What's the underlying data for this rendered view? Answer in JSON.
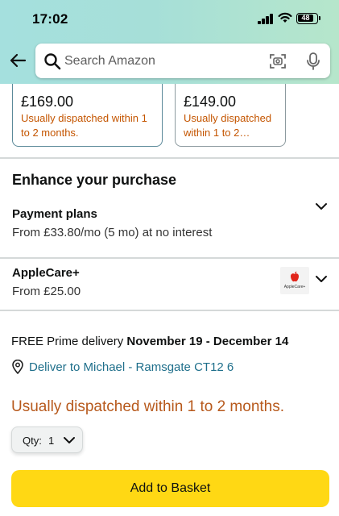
{
  "status_bar": {
    "time": "17:02",
    "battery": "48"
  },
  "search": {
    "placeholder": "Search Amazon"
  },
  "offers": [
    {
      "price": "£169.00",
      "note": "Usually dispatched within 1 to 2 months.",
      "selected": true
    },
    {
      "price": "£149.00",
      "note": "Usually dispatched within 1 to 2…",
      "selected": false
    }
  ],
  "enhance": {
    "title": "Enhance your purchase",
    "payment_plans": {
      "title": "Payment plans",
      "subtitle": "From £33.80/mo (5 mo) at no interest"
    },
    "applecare": {
      "title": "AppleCare+",
      "subtitle": "From £25.00",
      "thumb_label": "AppleCare+"
    }
  },
  "delivery": {
    "prefix": "FREE Prime delivery",
    "dates": "November 19 - December 14",
    "deliver_to": "Deliver to Michael - Ramsgate CT12 6"
  },
  "availability": "Usually dispatched within 1 to 2 months.",
  "quantity": {
    "label": "Qty:",
    "value": "1"
  },
  "add_to_basket": "Add to Basket",
  "colors": {
    "accent_yellow": "#ffd814",
    "availability_orange": "#b7591c",
    "link_teal": "#1f6f8b"
  }
}
